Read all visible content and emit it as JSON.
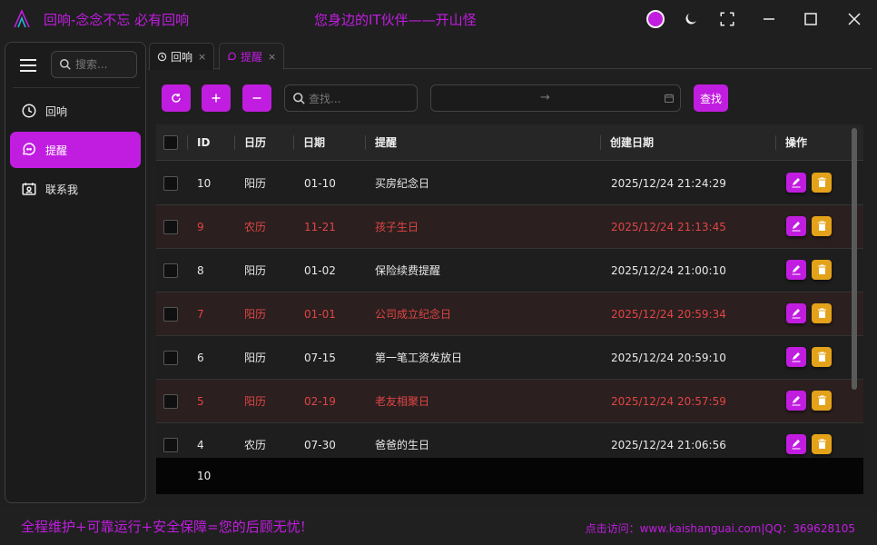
{
  "window": {
    "title": "回响-念念不忘 必有回响",
    "slogan": "您身边的IT伙伴——开山怪",
    "accent": "#c11de0"
  },
  "sidebar": {
    "search_placeholder": "搜索...",
    "items": [
      {
        "label": "回响",
        "icon": "clock-icon",
        "active": false
      },
      {
        "label": "提醒",
        "icon": "chat-bubble-icon",
        "active": true
      },
      {
        "label": "联系我",
        "icon": "contact-card-icon",
        "active": false
      }
    ]
  },
  "tabs": [
    {
      "label": "回响",
      "icon": "clock-icon",
      "active": false
    },
    {
      "label": "提醒",
      "icon": "chat-bubble-icon",
      "active": true
    }
  ],
  "toolbar": {
    "refresh_icon": "refresh-icon",
    "add_icon": "plus-icon",
    "remove_icon": "minus-icon",
    "find_placeholder": "查找...",
    "date_range_separator": "→",
    "query_label": "查找"
  },
  "table": {
    "columns": [
      "ID",
      "日历",
      "日期",
      "提醒",
      "创建日期",
      "操作"
    ],
    "rows": [
      {
        "id": "10",
        "calendar": "阳历",
        "date": "01-10",
        "reminder": "买房纪念日",
        "created": "2025/12/24 21:24:29",
        "highlight": false
      },
      {
        "id": "9",
        "calendar": "农历",
        "date": "11-21",
        "reminder": "孩子生日",
        "created": "2025/12/24 21:13:45",
        "highlight": true
      },
      {
        "id": "8",
        "calendar": "阳历",
        "date": "01-02",
        "reminder": "保险续费提醒",
        "created": "2025/12/24 21:00:10",
        "highlight": false
      },
      {
        "id": "7",
        "calendar": "阳历",
        "date": "01-01",
        "reminder": "公司成立纪念日",
        "created": "2025/12/24 20:59:34",
        "highlight": true
      },
      {
        "id": "6",
        "calendar": "阳历",
        "date": "07-15",
        "reminder": "第一笔工资发放日",
        "created": "2025/12/24 20:59:10",
        "highlight": false
      },
      {
        "id": "5",
        "calendar": "阳历",
        "date": "02-19",
        "reminder": "老友相聚日",
        "created": "2025/12/24 20:57:59",
        "highlight": true
      },
      {
        "id": "4",
        "calendar": "农历",
        "date": "07-30",
        "reminder": "爸爸的生日",
        "created": "2025/12/24 21:06:56",
        "highlight": false
      }
    ],
    "footer_count": "10",
    "highlight_color": "#e04545"
  },
  "footer": {
    "slogan": "全程维护+可靠运行+安全保障=您的后顾无忧!",
    "visit": "点击访问：www.kaishanguai.com|QQ：369628105"
  }
}
